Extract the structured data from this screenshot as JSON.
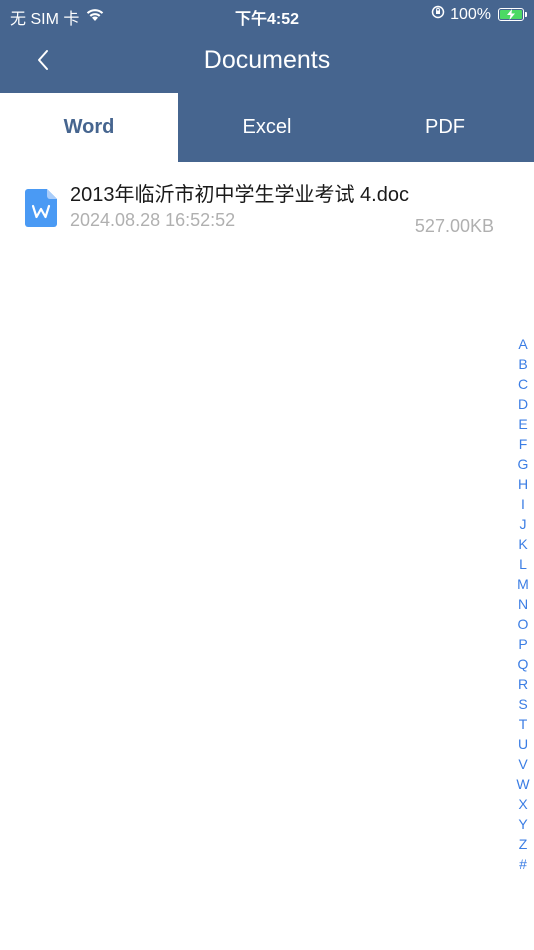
{
  "status_bar": {
    "carrier": "无 SIM 卡",
    "time": "下午4:52",
    "battery": "100%",
    "icons": [
      "wifi-icon",
      "orientation-lock-icon",
      "battery-charging-icon"
    ]
  },
  "nav": {
    "back_icon": "chevron-left-icon",
    "title": "Documents"
  },
  "tabs": [
    {
      "label": "Word",
      "active": true
    },
    {
      "label": "Excel",
      "active": false
    },
    {
      "label": "PDF",
      "active": false
    }
  ],
  "files": [
    {
      "icon": "word-document-icon",
      "name": "2013年临沂市初中学生学业考试 4.doc",
      "date": "2024.08.28 16:52:52",
      "size": "527.00KB"
    }
  ],
  "index": [
    "A",
    "B",
    "C",
    "D",
    "E",
    "F",
    "G",
    "H",
    "I",
    "J",
    "K",
    "L",
    "M",
    "N",
    "O",
    "P",
    "Q",
    "R",
    "S",
    "T",
    "U",
    "V",
    "W",
    "X",
    "Y",
    "Z",
    "#"
  ],
  "colors": {
    "header": "#46658f",
    "index_accent": "#3b7de4",
    "word_icon": "#4a9af4"
  }
}
